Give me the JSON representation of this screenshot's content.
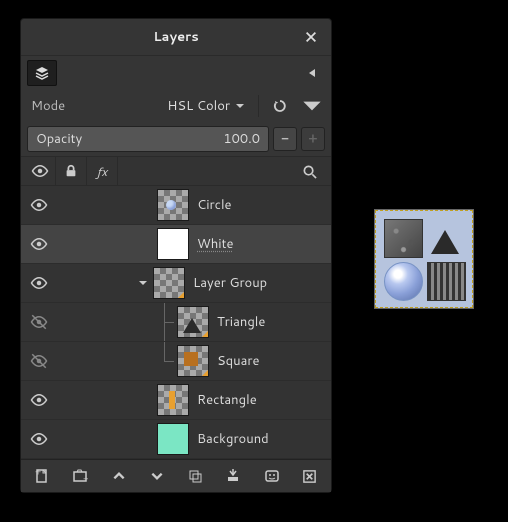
{
  "panel": {
    "title": "Layers"
  },
  "mode": {
    "label": "Mode",
    "value": "HSL Color"
  },
  "opacity": {
    "label": "Opacity",
    "value": "100.0"
  },
  "layers": [
    {
      "name": "Circle",
      "visible": true,
      "depth": 0,
      "selected": false,
      "thumb": "circle",
      "expander": false
    },
    {
      "name": "White",
      "visible": true,
      "depth": 0,
      "selected": true,
      "thumb": "white",
      "expander": false
    },
    {
      "name": "Layer Group",
      "visible": true,
      "depth": 0,
      "selected": false,
      "thumb": "group",
      "expander": true
    },
    {
      "name": "Triangle",
      "visible": false,
      "depth": 1,
      "selected": false,
      "thumb": "triangle",
      "expander": false,
      "branch": true
    },
    {
      "name": "Square",
      "visible": false,
      "depth": 1,
      "selected": false,
      "thumb": "square",
      "expander": false,
      "branch": true,
      "last": true
    },
    {
      "name": "Rectangle",
      "visible": true,
      "depth": 0,
      "selected": false,
      "thumb": "rect",
      "expander": false
    },
    {
      "name": "Background",
      "visible": true,
      "depth": 0,
      "selected": false,
      "thumb": "mint",
      "expander": false
    }
  ]
}
